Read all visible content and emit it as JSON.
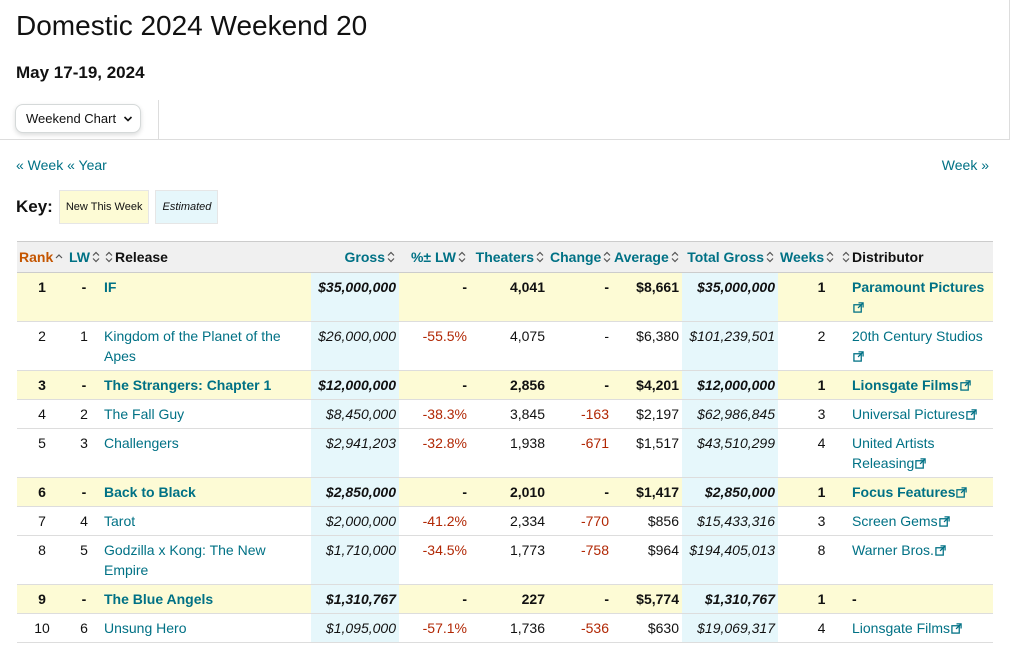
{
  "page": {
    "title": "Domestic 2024 Weekend 20",
    "date_range": "May 17-19, 2024",
    "view_selector": "Weekend Chart"
  },
  "nav": {
    "prev_week": "« Week",
    "prev_year": "« Year",
    "next_week": "Week »"
  },
  "key": {
    "label": "Key:",
    "new_this_week": "New This Week",
    "estimated": "Estimated"
  },
  "table": {
    "headers": [
      "Rank",
      "LW",
      "Release",
      "Gross",
      "%± LW",
      "Theaters",
      "Change",
      "Average",
      "Total Gross",
      "Weeks",
      "Distributor"
    ],
    "rows": [
      {
        "rank": "1",
        "lw": "-",
        "release": "IF",
        "gross": "$35,000,000",
        "pct": "-",
        "theaters": "4,041",
        "change": "-",
        "average": "$8,661",
        "total": "$35,000,000",
        "weeks": "1",
        "distributor": "Paramount Pictures",
        "new": true
      },
      {
        "rank": "2",
        "lw": "1",
        "release": "Kingdom of the Planet of the Apes",
        "gross": "$26,000,000",
        "pct": "-55.5%",
        "theaters": "4,075",
        "change": "-",
        "average": "$6,380",
        "total": "$101,239,501",
        "weeks": "2",
        "distributor": "20th Century Studios",
        "new": false
      },
      {
        "rank": "3",
        "lw": "-",
        "release": "The Strangers: Chapter 1",
        "gross": "$12,000,000",
        "pct": "-",
        "theaters": "2,856",
        "change": "-",
        "average": "$4,201",
        "total": "$12,000,000",
        "weeks": "1",
        "distributor": "Lionsgate Films",
        "new": true
      },
      {
        "rank": "4",
        "lw": "2",
        "release": "The Fall Guy",
        "gross": "$8,450,000",
        "pct": "-38.3%",
        "theaters": "3,845",
        "change": "-163",
        "average": "$2,197",
        "total": "$62,986,845",
        "weeks": "3",
        "distributor": "Universal Pictures",
        "new": false
      },
      {
        "rank": "5",
        "lw": "3",
        "release": "Challengers",
        "gross": "$2,941,203",
        "pct": "-32.8%",
        "theaters": "1,938",
        "change": "-671",
        "average": "$1,517",
        "total": "$43,510,299",
        "weeks": "4",
        "distributor": "United Artists Releasing",
        "new": false
      },
      {
        "rank": "6",
        "lw": "-",
        "release": "Back to Black",
        "gross": "$2,850,000",
        "pct": "-",
        "theaters": "2,010",
        "change": "-",
        "average": "$1,417",
        "total": "$2,850,000",
        "weeks": "1",
        "distributor": "Focus Features",
        "new": true
      },
      {
        "rank": "7",
        "lw": "4",
        "release": "Tarot",
        "gross": "$2,000,000",
        "pct": "-41.2%",
        "theaters": "2,334",
        "change": "-770",
        "average": "$856",
        "total": "$15,433,316",
        "weeks": "3",
        "distributor": "Screen Gems",
        "new": false
      },
      {
        "rank": "8",
        "lw": "5",
        "release": "Godzilla x Kong: The New Empire",
        "gross": "$1,710,000",
        "pct": "-34.5%",
        "theaters": "1,773",
        "change": "-758",
        "average": "$964",
        "total": "$194,405,013",
        "weeks": "8",
        "distributor": "Warner Bros.",
        "new": false
      },
      {
        "rank": "9",
        "lw": "-",
        "release": "The Blue Angels",
        "gross": "$1,310,767",
        "pct": "-",
        "theaters": "227",
        "change": "-",
        "average": "$5,774",
        "total": "$1,310,767",
        "weeks": "1",
        "distributor": "-",
        "new": true
      },
      {
        "rank": "10",
        "lw": "6",
        "release": "Unsung Hero",
        "gross": "$1,095,000",
        "pct": "-57.1%",
        "theaters": "1,736",
        "change": "-536",
        "average": "$630",
        "total": "$19,069,317",
        "weeks": "4",
        "distributor": "Lionsgate Films",
        "new": false
      }
    ]
  },
  "colors": {
    "link": "#007185",
    "active_sort": "#c45500",
    "negative": "#b12704",
    "new_row_bg": "#fdfbd5",
    "estimated_bg": "#e6f7fb"
  }
}
